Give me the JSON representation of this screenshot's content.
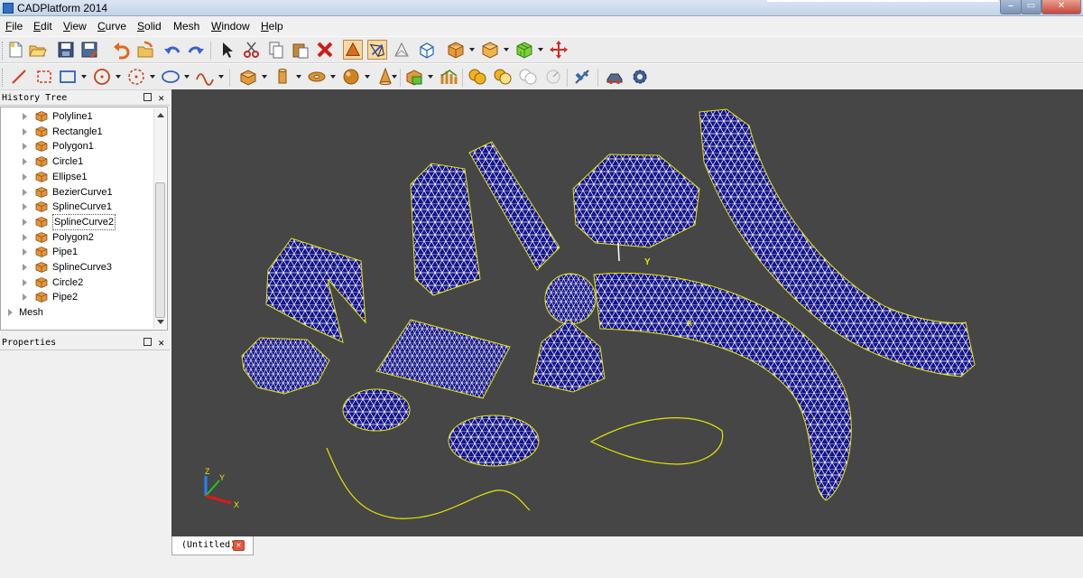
{
  "window": {
    "title": "CADPlatform 2014"
  },
  "menu": [
    {
      "label": "File",
      "mnemonic": "F",
      "rest": "ile"
    },
    {
      "label": "Edit",
      "mnemonic": "E",
      "rest": "dit"
    },
    {
      "label": "View",
      "mnemonic": "V",
      "rest": "iew"
    },
    {
      "label": "Curve",
      "mnemonic": "C",
      "rest": "urve"
    },
    {
      "label": "Solid",
      "mnemonic": "S",
      "rest": "olid"
    },
    {
      "label": "Mesh",
      "mnemonic": "",
      "rest": "Mesh"
    },
    {
      "label": "Window",
      "mnemonic": "W",
      "rest": "indow"
    },
    {
      "label": "Help",
      "mnemonic": "H",
      "rest": "elp"
    }
  ],
  "toolbar1": [
    "new-document-icon",
    "open-folder-icon",
    "save-icon",
    "save-as-icon",
    "undo-icon",
    "open-solid-icon",
    "redo-left-icon",
    "redo-right-icon",
    "select-arrow-icon",
    "cut-icon",
    "copy-icon",
    "paste-icon",
    "delete-icon",
    "shaded-view-icon",
    "wireframe-view-icon",
    "hidden-line-icon",
    "box-view-icon",
    "solid-box-icon",
    "solid-box-yellow-icon",
    "mesh-green-icon",
    "move-icon"
  ],
  "toolbar2": [
    "line-icon",
    "rectangle-dashed-icon",
    "rectangle-icon",
    "circle-icon",
    "circle-dashed-icon",
    "ellipse-icon",
    "spline-icon",
    "box-icon",
    "cylinder-icon",
    "torus-icon",
    "sphere-icon",
    "cone-icon",
    "boolean-icon",
    "sweep-icon",
    "union-icon",
    "subtract-icon",
    "intersect-icon",
    "analysis-icon",
    "render-icon",
    "settings-gear-icon"
  ],
  "history_tree": {
    "title": "History Tree",
    "items": [
      {
        "label": "Polyline1",
        "selected": false
      },
      {
        "label": "Rectangle1",
        "selected": false
      },
      {
        "label": "Polygon1",
        "selected": false
      },
      {
        "label": "Circle1",
        "selected": false
      },
      {
        "label": "Ellipse1",
        "selected": false
      },
      {
        "label": "BezierCurve1",
        "selected": false
      },
      {
        "label": "SplineCurve1",
        "selected": false
      },
      {
        "label": "SplineCurve2",
        "selected": true
      },
      {
        "label": "Polygon2",
        "selected": false
      },
      {
        "label": "Pipe1",
        "selected": false
      },
      {
        "label": "SplineCurve3",
        "selected": false
      },
      {
        "label": "Circle2",
        "selected": false
      },
      {
        "label": "Pipe2",
        "selected": false
      }
    ],
    "root": "Mesh"
  },
  "properties": {
    "title": "Properties"
  },
  "viewport": {
    "axis_labels": {
      "z": "Z",
      "y": "Y",
      "x": "X"
    },
    "gizmo_labels": {
      "y": "Y",
      "x": "X"
    },
    "colors": {
      "background": "#464646",
      "mesh_fill": "#14148a",
      "mesh_edge": "#ffffff",
      "outline": "#e6e600"
    }
  },
  "tabs": [
    {
      "label": "(Untitled)",
      "close_icon": "close-icon"
    }
  ],
  "panel_buttons": {
    "float": "float-icon",
    "close": "✕"
  }
}
